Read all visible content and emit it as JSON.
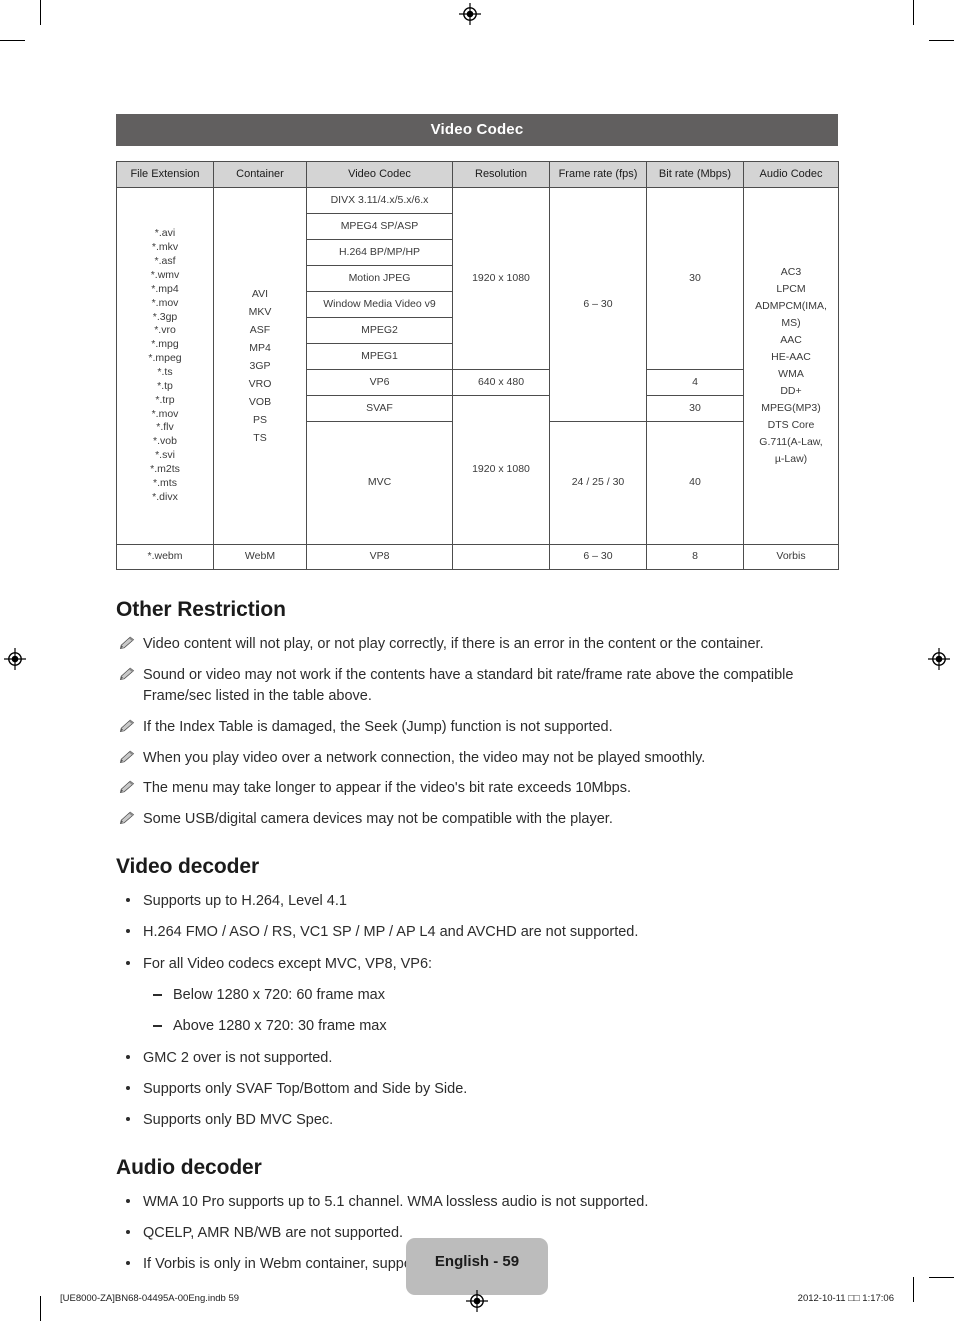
{
  "section_band": {
    "title": "Video Codec"
  },
  "table": {
    "headers": [
      "File Extension",
      "Container",
      "Video Codec",
      "Resolution",
      "Frame rate (fps)",
      "Bit rate (Mbps)",
      "Audio Codec"
    ],
    "file_extensions": "*.avi\n*.mkv\n*.asf\n*.wmv\n*.mp4\n*.mov\n*.3gp\n*.vro\n*.mpg\n*.mpeg\n*.ts\n*.tp\n*.trp\n*.mov\n*.flv\n*.vob\n*.svi\n*.m2ts\n*.mts\n*.divx",
    "containers": "AVI\nMKV\nASF\nMP4\n3GP\nVRO\nVOB\nPS\nTS",
    "video_codecs": [
      "DIVX 3.11/4.x/5.x/6.x",
      "MPEG4 SP/ASP",
      "H.264 BP/MP/HP",
      "Motion JPEG",
      "Window Media Video v9",
      "MPEG2",
      "MPEG1",
      "VP6",
      "SVAF",
      "MVC"
    ],
    "resolution_main": "1920 x 1080",
    "resolution_vp6": "640 x 480",
    "resolution_mvc": "1920 x 1080",
    "framerate_main": "6 – 30",
    "framerate_mvc": "24 / 25 / 30",
    "bitrate_main": "30",
    "bitrate_vp6": "4",
    "bitrate_svaf": "30",
    "bitrate_mvc": "40",
    "audio_codec_main": "AC3\nLPCM\nADMPCM(IMA,\nMS)\nAAC\nHE-AAC\nWMA\nDD+\nMPEG(MP3)\nDTS Core\nG.711(A-Law,\nµ-Law)",
    "webm_row": {
      "extension": "*.webm",
      "container": "WebM",
      "video_codec": "VP8",
      "resolution": "",
      "frame_rate": "6 – 30",
      "bit_rate": "8",
      "audio_codec": "Vorbis"
    }
  },
  "other_restriction": {
    "heading": "Other Restriction",
    "items": [
      "Video content will not play, or not play correctly, if there is an error in the content or the container.",
      "Sound or video may not work if the contents have a standard bit rate/frame rate above the compatible Frame/sec listed in the table above.",
      "If the Index Table is damaged, the Seek (Jump) function is not supported.",
      "When you play video over a network connection, the video may not be played smoothly.",
      "The menu may take longer to appear if the video's bit rate exceeds 10Mbps.",
      "Some USB/digital camera devices may not be compatible with the player."
    ]
  },
  "video_decoder": {
    "heading": "Video decoder",
    "items": [
      "Supports up to H.264, Level 4.1",
      "H.264 FMO / ASO / RS, VC1 SP / MP / AP L4 and AVCHD are not supported.",
      "For all Video codecs except MVC, VP8, VP6:",
      "GMC 2 over is not supported.",
      "Supports only SVAF Top/Bottom and Side by Side.",
      "Supports only BD MVC Spec."
    ],
    "sub_items": [
      "Below 1280 x 720: 60 frame max",
      "Above 1280 x 720: 30 frame max"
    ]
  },
  "audio_decoder": {
    "heading": "Audio decoder",
    "items": [
      "WMA 10 Pro supports up to 5.1 channel. WMA lossless audio is not supported.",
      "QCELP, AMR NB/WB are not supported.",
      "If Vorbis is only in Webm container, supports up to 2 channel."
    ]
  },
  "footer": {
    "page_label": "English - 59",
    "file_info": "[UE8000-ZA]BN68-04495A-00Eng.indb   59",
    "timestamp": "2012-10-11   □□ 1:17:06"
  },
  "colors": {
    "band": "#615f5f",
    "header_cell": "#d4d4d4",
    "badge": "#bcbcbc",
    "text": "#231f20"
  }
}
